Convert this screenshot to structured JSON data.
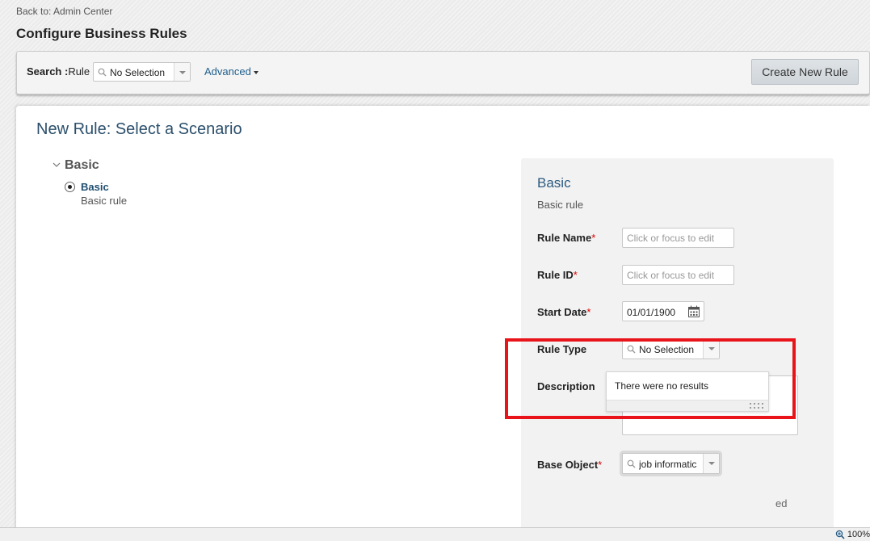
{
  "header": {
    "back_link": "Back to: Admin Center",
    "page_title": "Configure Business Rules"
  },
  "search_bar": {
    "label_bold": "Search :",
    "label_rest": "Rule",
    "combo_value": "No Selection",
    "advanced_label": "Advanced",
    "create_button": "Create New Rule"
  },
  "main": {
    "title": "New Rule: Select a Scenario",
    "tree": {
      "group_label": "Basic",
      "items": [
        {
          "name": "Basic",
          "description": "Basic rule",
          "selected": true
        }
      ]
    }
  },
  "form": {
    "title": "Basic",
    "subtitle": "Basic rule",
    "required_marker": "*",
    "fields": {
      "rule_name": {
        "label": "Rule Name",
        "placeholder": "Click or focus to edit",
        "required": true
      },
      "rule_id": {
        "label": "Rule ID",
        "placeholder": "Click or focus to edit",
        "required": true
      },
      "start_date": {
        "label": "Start Date",
        "value": "01/01/1900",
        "required": true
      },
      "rule_type": {
        "label": "Rule Type",
        "value": "No Selection"
      },
      "description": {
        "label": "Description"
      },
      "base_object": {
        "label": "Base Object",
        "value": "job informatic",
        "required": true
      }
    },
    "dropdown_message": "There were no results",
    "obscured_text": "ed"
  },
  "status_bar": {
    "zoom": "100%"
  },
  "colors": {
    "highlight": "#e8141a",
    "link": "#1f5e8c",
    "title_blue": "#2b4f6b"
  }
}
